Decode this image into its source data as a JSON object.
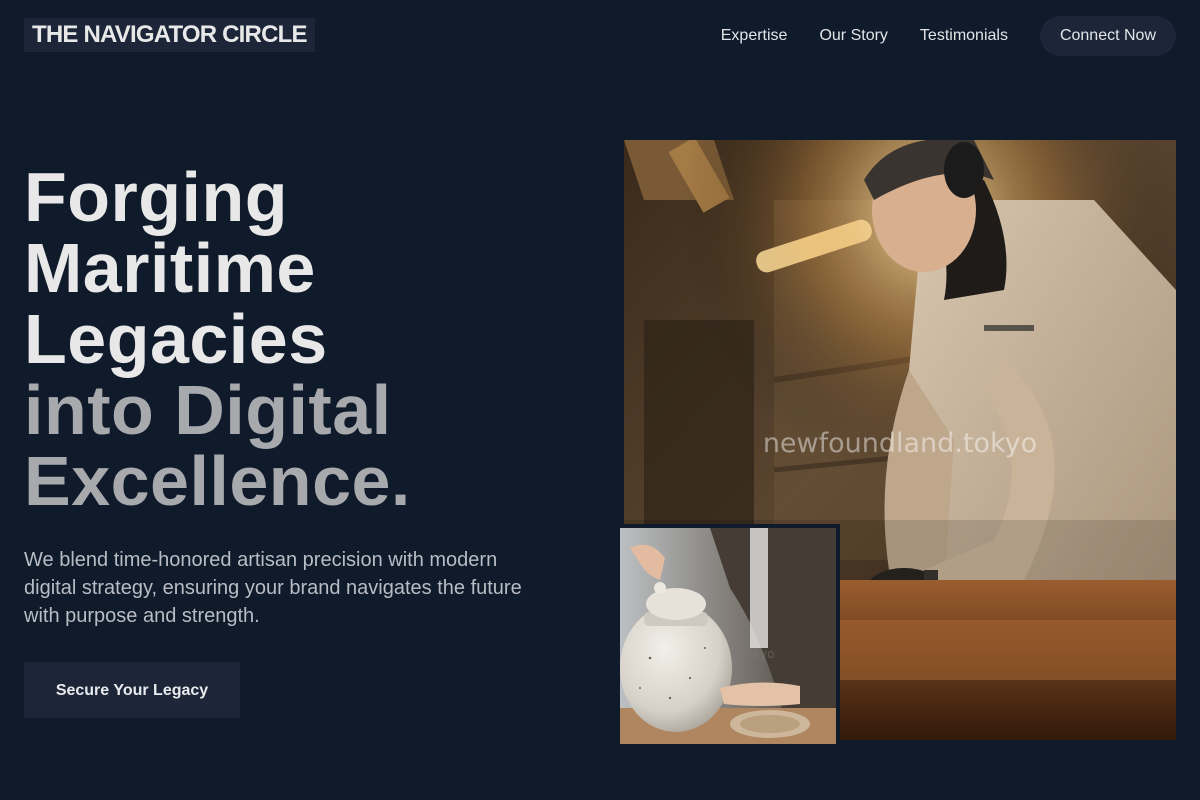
{
  "header": {
    "logo_text": "THE NAVIGATOR CIRCLE",
    "nav": [
      {
        "label": "Expertise"
      },
      {
        "label": "Our Story"
      },
      {
        "label": "Testimonials"
      }
    ],
    "cta_label": "Connect Now"
  },
  "hero": {
    "headline_lines": [
      "Forging",
      "Maritime",
      "Legacies",
      "into Digital",
      "Excellence."
    ],
    "lede": "We blend time-honored artisan precision with modern digital strategy, ensuring your brand navigates the future with purpose and strength.",
    "button_label": "Secure Your Legacy"
  },
  "images": {
    "main_watermark": "newfoundland.tokyo",
    "inset_watermark": "d.tokyo"
  },
  "colors": {
    "background": "#0f1a2a",
    "surface": "#1c2638",
    "headline_light": "#e8e8e8",
    "headline_muted": "#a7a9ad"
  }
}
